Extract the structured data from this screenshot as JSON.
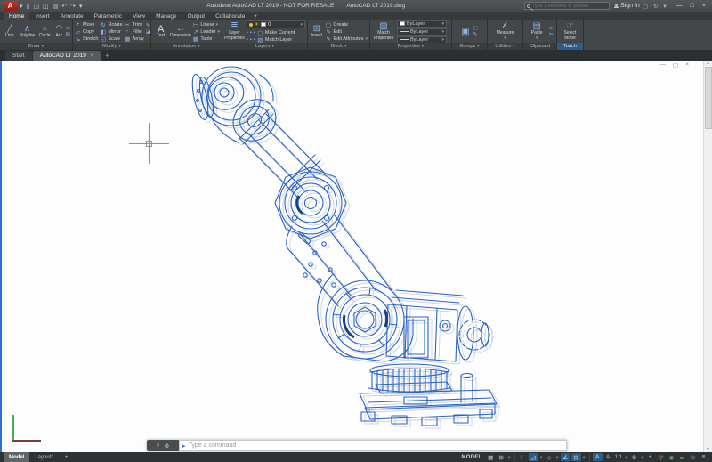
{
  "titlebar": {
    "title": "Autodesk AutoCAD LT 2019 - NOT FOR RESALE",
    "doc": "AutoCAD LT 2019.dwg",
    "search_placeholder": "Type a keyword or phrase",
    "sign_in": "Sign In"
  },
  "ribbon": {
    "tabs": [
      "Home",
      "Insert",
      "Annotate",
      "Parametric",
      "View",
      "Manage",
      "Output",
      "Collaborate"
    ],
    "active_tab": "Home",
    "panels": {
      "draw": {
        "label": "Draw",
        "line": "Line",
        "polyline": "Polyline",
        "circle": "Circle",
        "arc": "Arc"
      },
      "modify": {
        "label": "Modify",
        "move": "Move",
        "copy": "Copy",
        "stretch": "Stretch",
        "rotate": "Rotate",
        "mirror": "Mirror",
        "scale": "Scale",
        "trim": "Trim",
        "fillet": "Fillet",
        "array": "Array"
      },
      "annotation": {
        "label": "Annotation",
        "text": "Text",
        "dimension": "Dimension",
        "linear": "Linear",
        "leader": "Leader",
        "table": "Table"
      },
      "layers": {
        "label": "Layers",
        "layer_properties": "Layer Properties",
        "current_layer": "0",
        "make_current": "Make Current",
        "match_layer": "Match Layer"
      },
      "block": {
        "label": "Block",
        "insert": "Insert",
        "create": "Create",
        "edit": "Edit",
        "edit_attributes": "Edit Attributes"
      },
      "properties": {
        "label": "Properties",
        "match_properties": "Match Properties",
        "bylayer": "ByLayer"
      },
      "groups": {
        "label": "Groups"
      },
      "utilities": {
        "label": "Utilities",
        "measure": "Measure"
      },
      "clipboard": {
        "label": "Clipboard",
        "paste": "Paste"
      },
      "touch": {
        "label": "Touch",
        "select_mode": "Select Mode"
      }
    }
  },
  "file_tabs": {
    "start": "Start",
    "doc": "AutoCAD LT 2019"
  },
  "command_line": {
    "placeholder": "Type a command"
  },
  "status_bar": {
    "model_tab": "Model",
    "layout_tab": "Layout1",
    "model_indicator": "MODEL",
    "annotation_scale": "1:1"
  },
  "colors": {
    "drawing_blue": "#2a64c5",
    "drawing_ghost": "#aebad2",
    "active_tool_blue": "#2c5d86",
    "ucs_green": "#43b049",
    "ucs_red": "#7d3b3b",
    "canvas": "#fdfdfd"
  },
  "glyphs": {
    "dropdown": "▾",
    "new_file": "▯",
    "open_file": "◳",
    "save_file": "◫",
    "plot": "▤",
    "undo": "↶",
    "redo": "↷",
    "minimize": "—",
    "maximize": "□",
    "close": "×",
    "line": "╱",
    "polyline": "∧",
    "circle": "○",
    "arc": "◠",
    "rect_tool": "▭",
    "hatch_tool": "▨",
    "move": "+",
    "copy": "▱",
    "stretch": "↘",
    "rotate": "↻",
    "mirror": "◧",
    "scale": "◱",
    "trim": "✂",
    "fillet": "◜",
    "array": "▦",
    "erase": "✎",
    "explode": "◪",
    "more": "⋯",
    "text": "A",
    "dimension": "↔",
    "linear": "⊢",
    "leader": "↗",
    "table": "▦",
    "layer_props": "≣",
    "sun": "☀",
    "insert": "⊞",
    "create": "▢",
    "edit": "✎",
    "match_props": "▨",
    "group_a": "▣",
    "group_b": "▢",
    "measure": "∡",
    "paste": "▤",
    "select_mode": "☞",
    "cmd_close": "×",
    "cmd_wrench": "⚙",
    "cmd_arrow": "▸",
    "grid": "▦",
    "snap": "⊞",
    "ortho": "∟",
    "polar": "◿",
    "isodraft": "◇",
    "otrack": "∠",
    "osnap": "⊡",
    "annot": "A",
    "autoscale": "A",
    "gear": "⚙",
    "plus": "+",
    "filter": "▽",
    "isolate": "◉",
    "perf": "▭",
    "clean": "↻",
    "menu": "≡",
    "doc_minimize": "—",
    "doc_restore": "▢",
    "doc_close": "×",
    "scroll_up": "▲",
    "scroll_down": "▼"
  }
}
